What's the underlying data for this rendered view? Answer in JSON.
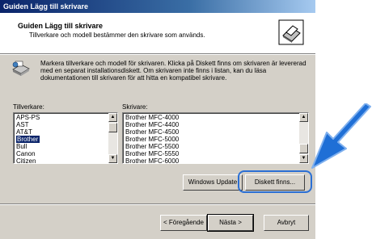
{
  "window": {
    "title": "Guiden Lägg till skrivare"
  },
  "header": {
    "title": "Guiden Lägg till skrivare",
    "subtitle": "Tillverkare och modell bestämmer den skrivare som används.",
    "icon": "printer-icon"
  },
  "instructions": {
    "text": "Markera tillverkare och modell för skrivaren. Klicka på Diskett finns om skrivaren är levererad med en separat installationsdiskett. Om skrivaren inte finns i listan, kan du läsa dokumentationen till skrivaren för att hitta en kompatibel skrivare.",
    "icon": "printer-install-icon"
  },
  "manufacturers": {
    "label": "Tillverkare:",
    "items": [
      "APS-PS",
      "AST",
      "AT&T",
      "Brother",
      "Bull",
      "Canon",
      "Citizen"
    ],
    "selected": "Brother"
  },
  "printers": {
    "label": "Skrivare:",
    "items": [
      "Brother MFC-4000",
      "Brother MFC-4400",
      "Brother MFC-4500",
      "Brother MFC-5000",
      "Brother MFC-5500",
      "Brother MFC-5550",
      "Brother MFC-6000"
    ]
  },
  "buttons": {
    "windows_update": "Windows Update",
    "have_disk": "Diskett finns...",
    "back": "< Föregående",
    "next": "Nästa >",
    "cancel": "Avbryt"
  },
  "colors": {
    "title_bar": "#0a246a",
    "selection": "#0a246a",
    "highlight_ring": "#2b6fd4",
    "callout_arrow": "#1f6fd6"
  }
}
